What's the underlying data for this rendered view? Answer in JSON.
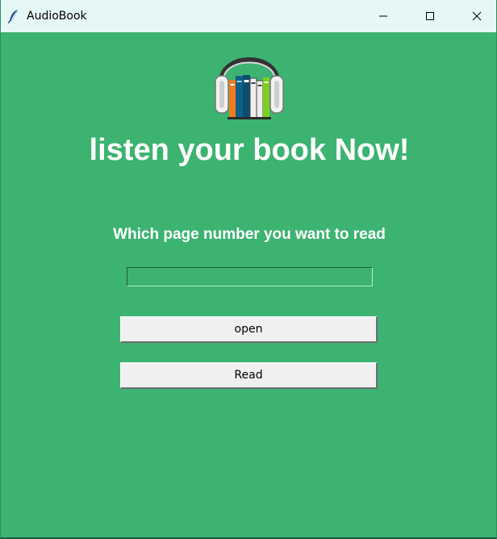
{
  "window": {
    "title": "AudioBook",
    "app_icon": "feather-icon",
    "controls": {
      "minimize_icon": "minimize-icon",
      "maximize_icon": "maximize-icon",
      "close_icon": "close-icon"
    }
  },
  "main": {
    "logo_icon": "headphones-books-icon",
    "headline": "listen your book Now!",
    "prompt": "Which page number you want to read",
    "page_input": {
      "value": "",
      "placeholder": ""
    },
    "buttons": {
      "open_label": "open",
      "read_label": "Read"
    }
  },
  "colors": {
    "background": "#3cb371",
    "titlebar": "#e6f8f6",
    "text": "#ffffff",
    "button": "#f0f0f0"
  }
}
